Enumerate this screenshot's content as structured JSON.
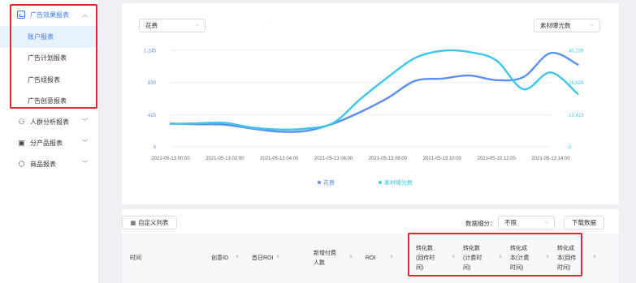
{
  "sidebar": {
    "group": {
      "label": "广告效果报表",
      "items": [
        {
          "label": "账户报表",
          "active": true
        },
        {
          "label": "广告计划报表",
          "active": false
        },
        {
          "label": "广告组报表",
          "active": false
        },
        {
          "label": "广告创意报表",
          "active": false
        }
      ]
    },
    "others": [
      {
        "label": "人群分析报表",
        "icon": "people-icon"
      },
      {
        "label": "分产品报表",
        "icon": "document-icon"
      },
      {
        "label": "商品报表",
        "icon": "box-icon"
      }
    ]
  },
  "chart": {
    "left_select": "花费",
    "right_select": "素材曝光数"
  },
  "chart_data": {
    "type": "line",
    "x": [
      "2021-05-13 00:00",
      "2021-05-13 02:00",
      "2021-05-13 04:00",
      "2021-05-13 06:00",
      "2021-05-13 08:00",
      "2021-05-13 10:00",
      "2021-05-13 12:00",
      "2021-05-13 14:00"
    ],
    "x_tick_labels": [
      "2021-05-13 00:00",
      "2021-05-13 02:00",
      "2021-05-13 04:00",
      "2021-05-13 06:00",
      "2021-05-13 08:00",
      "2021-05-13 10:00",
      "2021-05-13 12:00",
      "2021-05-13 14:00"
    ],
    "y_left_ticks": [
      "0",
      "415",
      "830",
      "1,245"
    ],
    "y_right_ticks": [
      "0",
      "13,413",
      "26,826",
      "40,239"
    ],
    "y_left_range": [
      0,
      1245
    ],
    "y_right_range": [
      0,
      40239
    ],
    "series": [
      {
        "name": "花费",
        "axis": "left",
        "color": "#5b8ff0",
        "points": [
          [
            0,
            300
          ],
          [
            0.5,
            290
          ],
          [
            1,
            285
          ],
          [
            1.5,
            235
          ],
          [
            2,
            195
          ],
          [
            2.5,
            205
          ],
          [
            3,
            300
          ],
          [
            3.5,
            450
          ],
          [
            4,
            630
          ],
          [
            4.5,
            850
          ],
          [
            5,
            880
          ],
          [
            5.5,
            920
          ],
          [
            6,
            860
          ],
          [
            6.5,
            900
          ],
          [
            7,
            1210
          ],
          [
            7.5,
            1060
          ]
        ]
      },
      {
        "name": "素材曝光数",
        "axis": "right",
        "color": "#3ec7e8",
        "points": [
          [
            0,
            9500
          ],
          [
            0.5,
            9800
          ],
          [
            1,
            10000
          ],
          [
            1.5,
            8000
          ],
          [
            2,
            7200
          ],
          [
            2.5,
            7600
          ],
          [
            3,
            10000
          ],
          [
            3.5,
            20000
          ],
          [
            4,
            29000
          ],
          [
            4.5,
            37000
          ],
          [
            5,
            40000
          ],
          [
            5.5,
            39500
          ],
          [
            6,
            36000
          ],
          [
            6.5,
            24000
          ],
          [
            7,
            31000
          ],
          [
            7.5,
            22000
          ]
        ]
      }
    ],
    "grid": true,
    "legend_position": "bottom"
  },
  "table": {
    "custom_button": "自定义列表",
    "granularity_label": "数据细分：",
    "granularity_value": "不限",
    "download_button": "下载数据",
    "headers": [
      "时间",
      "创意ID",
      "首日ROI",
      "新增付费\n人数",
      "ROI",
      "转化数\n(回传时\n间)",
      "转化数\n(计费时\n间)",
      "转化成\n本(计费\n时间)",
      "转化成\n本(回传\n时间)"
    ]
  },
  "colors": {
    "accent": "#3a7cf0",
    "highlight": "#e4252b"
  }
}
